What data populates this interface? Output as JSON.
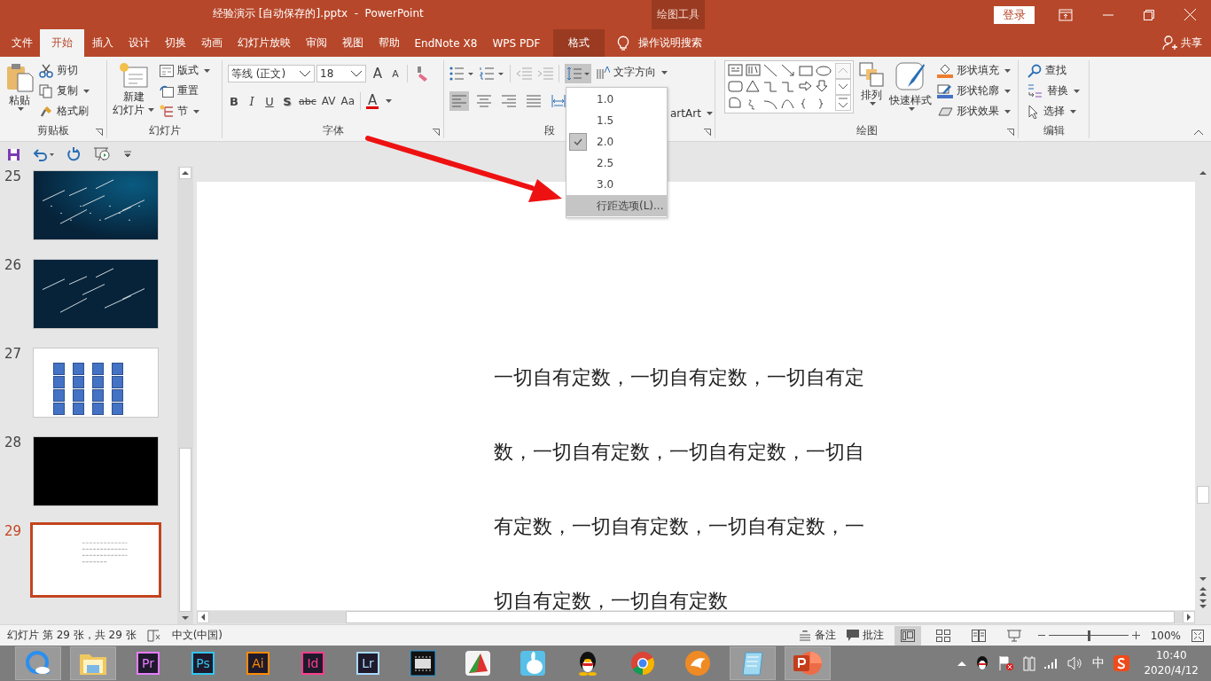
{
  "window": {
    "title": "经验演示 [自动保存的].pptx  -  PowerPoint",
    "context_group": "绘图工具",
    "sign_in": "登录"
  },
  "tabs": [
    {
      "label": "文件",
      "selected": false,
      "kind": "normal"
    },
    {
      "label": "开始",
      "selected": true,
      "kind": "normal"
    },
    {
      "label": "插入",
      "selected": false,
      "kind": "normal"
    },
    {
      "label": "设计",
      "selected": false,
      "kind": "normal"
    },
    {
      "label": "切换",
      "selected": false,
      "kind": "normal"
    },
    {
      "label": "动画",
      "selected": false,
      "kind": "normal"
    },
    {
      "label": "幻灯片放映",
      "selected": false,
      "kind": "normal"
    },
    {
      "label": "审阅",
      "selected": false,
      "kind": "normal"
    },
    {
      "label": "视图",
      "selected": false,
      "kind": "normal"
    },
    {
      "label": "帮助",
      "selected": false,
      "kind": "normal"
    },
    {
      "label": "EndNote X8",
      "selected": false,
      "kind": "normal"
    },
    {
      "label": "WPS PDF",
      "selected": false,
      "kind": "normal"
    },
    {
      "label": "格式",
      "selected": false,
      "kind": "contextual"
    }
  ],
  "tell_me": "操作说明搜索",
  "share": "共享",
  "ribbon": {
    "clipboard": {
      "label": "剪贴板",
      "paste": "粘贴",
      "cut": "剪切",
      "copy": "复制",
      "format_painter": "格式刷"
    },
    "slides": {
      "label": "幻灯片",
      "new_slide": "新建",
      "new_slide_2": "幻灯片",
      "layout": "版式",
      "reset": "重置",
      "section": "节"
    },
    "font": {
      "label": "字体",
      "font_name": "等线 (正文)",
      "font_size": "18",
      "grow": "A",
      "shrink": "A",
      "font_color": "A",
      "format_buttons": [
        {
          "label": "B",
          "kind": "bold"
        },
        {
          "label": "I",
          "kind": "italic"
        },
        {
          "label": "U",
          "kind": "underline"
        },
        {
          "label": "S",
          "kind": "shadow"
        },
        {
          "label": "abc",
          "kind": "strike"
        },
        {
          "label": "AV",
          "kind": "spacing"
        },
        {
          "label": "Aa",
          "kind": "case"
        }
      ]
    },
    "paragraph": {
      "label": "段",
      "line_spacing_open": true,
      "text_direction": "文字方向",
      "smartart": "artArt",
      "alignments": [
        {
          "selected": true
        },
        {
          "selected": false
        },
        {
          "selected": false
        },
        {
          "selected": false
        },
        {
          "selected": false
        }
      ]
    },
    "drawing": {
      "label": "绘图",
      "arrange": "排列",
      "quick_styles": "快速样式",
      "fill": "形状填充",
      "outline": "形状轮廓",
      "effects": "形状效果"
    },
    "editing": {
      "label": "编辑",
      "find": "查找",
      "replace": "替换",
      "select": "选择"
    }
  },
  "line_spacing_menu": {
    "items": [
      {
        "label": "1.0",
        "checked": false,
        "highlighted": false
      },
      {
        "label": "1.5",
        "checked": false,
        "highlighted": false
      },
      {
        "label": "2.0",
        "checked": true,
        "highlighted": false
      },
      {
        "label": "2.5",
        "checked": false,
        "highlighted": false
      },
      {
        "label": "3.0",
        "checked": false,
        "highlighted": false
      },
      {
        "label": "行距选项(L)...",
        "checked": false,
        "highlighted": true
      }
    ]
  },
  "slide_panel": {
    "slides": [
      {
        "number": "25",
        "kind": "stars",
        "selected": false
      },
      {
        "number": "26",
        "kind": "meteors",
        "selected": false
      },
      {
        "number": "27",
        "kind": "grid",
        "selected": false
      },
      {
        "number": "28",
        "kind": "black",
        "selected": false
      },
      {
        "number": "29",
        "kind": "text",
        "selected": true
      }
    ]
  },
  "slide": {
    "lines": [
      "一切自有定数，一切自有定数，一切自有定",
      "数，一切自有定数，一切自有定数，一切自",
      "有定数，一切自有定数，一切自有定数，一",
      "切自有定数，一切自有定数"
    ]
  },
  "status_bar": {
    "slide_info": "幻灯片 第 29 张，共 29 张",
    "language": "中文(中国)",
    "notes": "备注",
    "comments": "批注",
    "views": [
      {
        "kind": "normal",
        "selected": true
      },
      {
        "kind": "sorter",
        "selected": false
      },
      {
        "kind": "reading",
        "selected": false
      },
      {
        "kind": "slideshow",
        "selected": false
      }
    ],
    "zoom_slider": {
      "level": 0.5
    },
    "zoom": "100%"
  },
  "taskbar": {
    "apps": [
      {
        "kind": "browser",
        "highlighted": true
      },
      {
        "kind": "folder",
        "highlighted": true
      },
      {
        "kind": "adobe",
        "label": "Pr",
        "color": "#e77cff",
        "highlighted": false
      },
      {
        "kind": "adobe",
        "label": "Ps",
        "color": "#31c5f0",
        "highlighted": false
      },
      {
        "kind": "adobe",
        "label": "Ai",
        "color": "#ff8a00",
        "highlighted": false
      },
      {
        "kind": "adobe",
        "label": "Id",
        "color": "#ff3d8b",
        "highlighted": false
      },
      {
        "kind": "adobe",
        "label": "Lr",
        "color": "#a9d8ff",
        "highlighted": false
      },
      {
        "kind": "film",
        "highlighted": false
      },
      {
        "kind": "chart",
        "highlighted": false
      },
      {
        "kind": "bunny",
        "highlighted": false
      },
      {
        "kind": "penguin",
        "highlighted": false
      },
      {
        "kind": "chrome",
        "highlighted": false
      },
      {
        "kind": "fox",
        "highlighted": false
      },
      {
        "kind": "notepad",
        "highlighted": true
      },
      {
        "kind": "ppt",
        "highlighted": true
      }
    ],
    "tray": {
      "ime": "中",
      "time": "10:40",
      "date": "2020/4/12"
    }
  }
}
